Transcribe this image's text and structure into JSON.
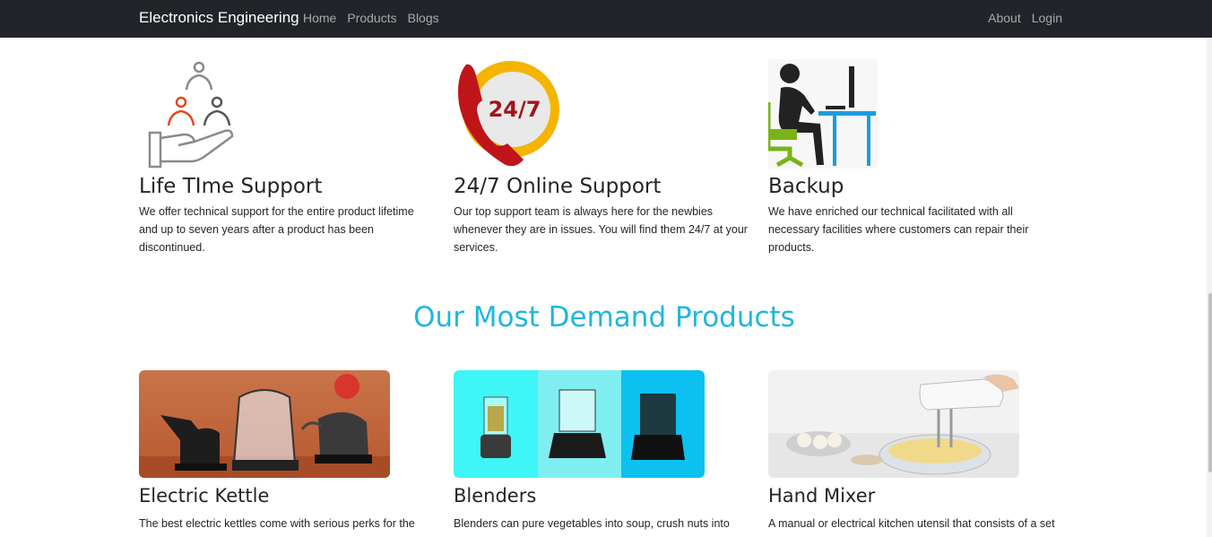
{
  "navbar": {
    "brand": "Electronics Engineering",
    "left_links": [
      "Home",
      "Products",
      "Blogs"
    ],
    "right_links": [
      "About",
      "Login"
    ]
  },
  "services": [
    {
      "title": "Life TIme Support",
      "text": "We offer technical support for the entire product lifetime and up to seven years after a product has been discontinued.",
      "icon": "support-hand-icon"
    },
    {
      "title": "24/7 Online Support",
      "text": "Our top support team is always here for the newbies whenever they are in issues. You will find them 24/7 at your services.",
      "icon": "phone-24-7-icon",
      "icon_text": "24/7"
    },
    {
      "title": "Backup",
      "text": "We have enriched our technical facilitated with all necessary facilities where customers can repair their products.",
      "icon": "person-at-desk-icon"
    }
  ],
  "section_title": "Our Most Demand Products",
  "products": [
    {
      "title": "Electric Kettle",
      "text": "The best electric kettles come with serious perks for the"
    },
    {
      "title": "Blenders",
      "text": "Blenders can pure vegetables into soup, crush nuts into"
    },
    {
      "title": "Hand Mixer",
      "text": "A manual or electrical kitchen utensil that consists of a set"
    }
  ],
  "colors": {
    "navbar_bg": "#212529",
    "accent": "#1fb7dc",
    "icon_orange": "#e0491b",
    "phone_red": "#c0141b",
    "badge_yellow": "#f4b400",
    "desk_blue": "#1e9be0",
    "chair_green": "#7ab317"
  }
}
